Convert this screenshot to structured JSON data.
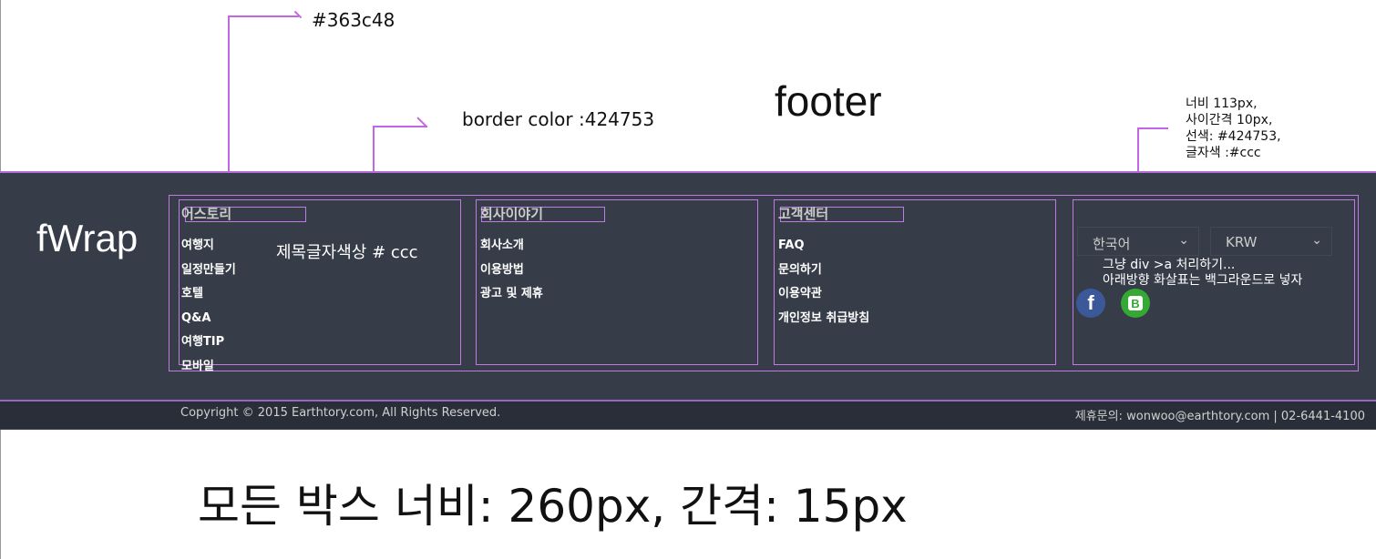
{
  "annotations": {
    "color_code": "#363c48",
    "footer_label": "footer",
    "border_color": "border color :424753",
    "right_note": [
      "너비 113px,",
      "사이간격 10px,",
      "선색: #424753,",
      "글자색 :#ccc"
    ],
    "title_color_note": "제목글자색상 # ccc",
    "fwrap_label": "fWrap",
    "div_note": [
      "그냥 div >a 처리하기...",
      "아래방향 화살표는 백그라운드로 넣자"
    ],
    "box_note": "모든 박스 너비: 260px, 간격: 15px"
  },
  "columns": [
    {
      "title": "어스토리",
      "items": [
        "여행지",
        "일정만들기",
        "호텔",
        "Q&A",
        "여행TIP",
        "모바일"
      ]
    },
    {
      "title": "회사이야기",
      "items": [
        "회사소개",
        "이용방법",
        "광고 및 제휴"
      ]
    },
    {
      "title": "고객센터",
      "items": [
        "FAQ",
        "문의하기",
        "이용약관",
        "개인정보 취급방침"
      ]
    }
  ],
  "selects": {
    "language": "한국어",
    "currency": "KRW"
  },
  "sns": [
    "facebook-icon",
    "blog-icon"
  ],
  "footer": {
    "copyright": "Copyright © 2015 Earthtory.com, All Rights Reserved.",
    "contact": "제휴문의: wonwoo@earthtory.com | 02-6441-4100"
  },
  "colors": {
    "footer_bg": "#363c48",
    "border": "#424753",
    "title_text": "#cccccc",
    "guide": "#c266e6"
  }
}
